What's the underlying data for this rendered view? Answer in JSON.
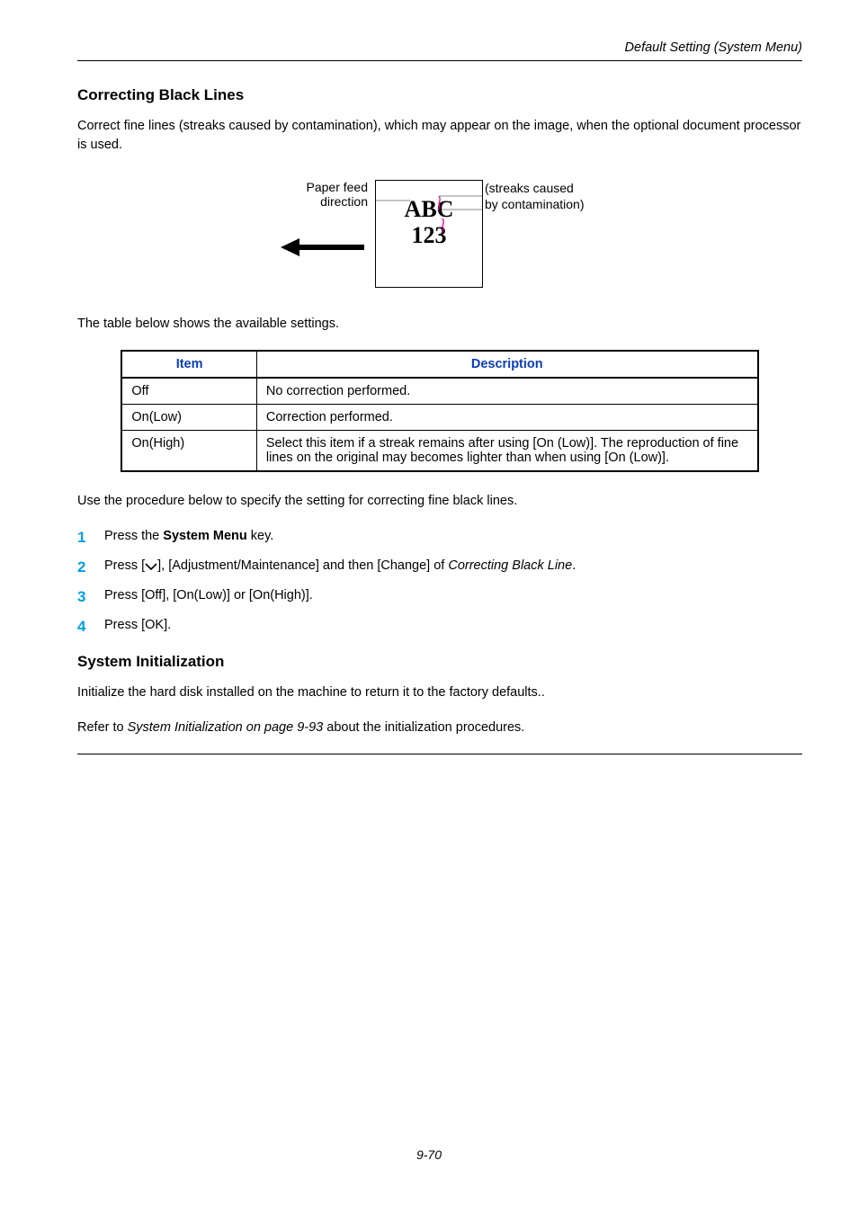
{
  "runningHead": "Default Setting (System Menu)",
  "section1": {
    "title": "Correcting Black Lines",
    "intro": "Correct fine lines (streaks caused by contamination), which may appear on the image, when the optional document processor is used.",
    "figLeft1": "Paper feed",
    "figLeft2": "direction",
    "figBoxLine1": "ABC",
    "figBoxLine2": "123",
    "figRight1": "(streaks caused",
    "figRight2": "by contamination)",
    "tableIntro": "The table below shows the available settings.",
    "table": {
      "h1": "Item",
      "h2": "Description",
      "rows": [
        {
          "c1": "Off",
          "c2": "No correction performed."
        },
        {
          "c1": "On(Low)",
          "c2": "Correction performed."
        },
        {
          "c1": "On(High)",
          "c2": "Select this item if a streak remains after using [On (Low)]. The reproduction of fine lines on the original may becomes lighter than when using [On (Low)]."
        }
      ]
    },
    "procIntro": "Use the procedure below to specify the setting for correcting fine black lines.",
    "steps": {
      "s1a": "Press the ",
      "s1b": "System Menu",
      "s1c": " key.",
      "s2a": "Press [",
      "s2b": "], [Adjustment/Maintenance] and then [Change] of ",
      "s2c": "Correcting Black Line",
      "s2d": ".",
      "s3": "Press [Off], [On(Low)] or [On(High)].",
      "s4": "Press [OK]."
    }
  },
  "section2": {
    "title": "System Initialization",
    "p1": "Initialize the hard disk installed on the machine to return it to the factory defaults..",
    "p2a": "Refer to ",
    "p2b": "System Initialization on page 9-93",
    "p2c": " about the initialization procedures."
  },
  "pageNum": "9-70"
}
